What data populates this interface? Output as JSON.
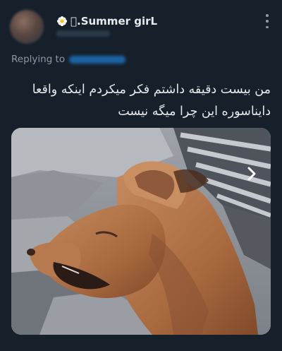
{
  "tweet": {
    "author": {
      "display_name": "􀀀.Summer girL",
      "avatar_icon": "profile-avatar-blurred",
      "handle": ""
    },
    "reply_to": {
      "label": "Replying to",
      "handle": ""
    },
    "text": "من بیست دقیقه داشتم فکر میکردم اینکه واقعا\nداینا‌سوره این چرا میگه نیست",
    "media": {
      "icon": "dog-video-thumbnail",
      "next_icon": "chevron-right-icon"
    },
    "menu_icon": "more-vertical-icon"
  },
  "colors": {
    "background": "#15202b",
    "text": "#e7e9ea",
    "secondary_text": "#8b98a5"
  }
}
